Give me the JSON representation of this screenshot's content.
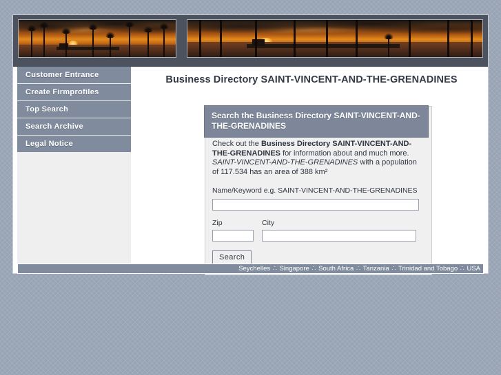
{
  "banner": {
    "left_image_alt": "sunset-palms-pier-photo",
    "right_image_alt": "sunset-pier-beach-photo"
  },
  "sidebar": {
    "items": [
      {
        "label": "Customer Entrance",
        "name": "sidebar-item-customer-entrance"
      },
      {
        "label": "Create Firmprofiles",
        "name": "sidebar-item-create-firmprofiles"
      },
      {
        "label": "Top Search",
        "name": "sidebar-item-top-search"
      },
      {
        "label": "Search Archive",
        "name": "sidebar-item-search-archive"
      },
      {
        "label": "Legal Notice",
        "name": "sidebar-item-legal-notice"
      }
    ]
  },
  "main": {
    "page_title": "Business Directory SAINT-VINCENT-AND-THE-GRENADINES"
  },
  "search_panel": {
    "header": "Search the Business Directory SAINT-VINCENT-AND-THE-GRENADINES",
    "intro": {
      "lead": "Check out the ",
      "bold": "Business Directory SAINT-VINCENT-AND-THE-GRENADINES",
      "after_bold": " for information about and much more. ",
      "italic": "SAINT-VINCENT-AND-THE-GRENADINES",
      "tail": " with a population of 117.534 has an area of 388 km²"
    },
    "keyword_label": "Name/Keyword e.g. SAINT-VINCENT-AND-THE-GRENADINES",
    "keyword_value": "",
    "keyword_placeholder": "",
    "zip_label": "Zip",
    "zip_value": "",
    "zip_placeholder": "",
    "city_label": "City",
    "city_value": "",
    "city_placeholder": "",
    "search_button": "Search"
  },
  "footer": {
    "separator": "∴",
    "links": [
      "Seychelles",
      "Singapore",
      "South Africa",
      "Tanzania",
      "Trinidad and Tobago",
      "USA"
    ]
  },
  "colors": {
    "background": "#98a3b4",
    "nav_button": "#808c9e",
    "panel_header": "#7d8799",
    "panel_body": "#f0f0f0",
    "banner_frame": "#4d535e",
    "title_text": "#333a45"
  }
}
